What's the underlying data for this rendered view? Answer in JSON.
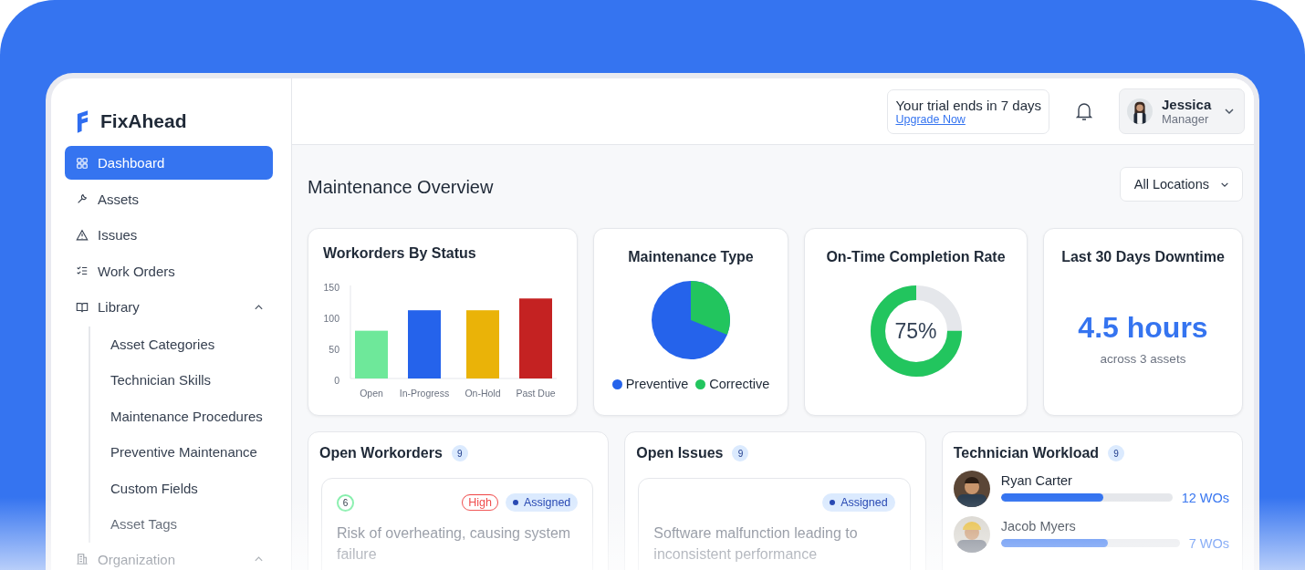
{
  "brand": {
    "name": "FixAhead"
  },
  "sidebar": {
    "items": [
      {
        "label": "Dashboard",
        "selected": true
      },
      {
        "label": "Assets",
        "selected": false
      },
      {
        "label": "Issues",
        "selected": false
      },
      {
        "label": "Work Orders",
        "selected": false
      },
      {
        "label": "Library",
        "selected": false,
        "expanded": true,
        "children": [
          {
            "label": "Asset Categories",
            "selected": false
          },
          {
            "label": "Technician Skills",
            "selected": false
          },
          {
            "label": "Maintenance Procedures",
            "selected": false
          },
          {
            "label": "Preventive Maintenance",
            "selected": false
          },
          {
            "label": "Custom Fields",
            "selected": false
          },
          {
            "label": "Asset Tags",
            "selected": false
          }
        ]
      },
      {
        "label": "Organization",
        "selected": false,
        "expanded": true
      }
    ]
  },
  "header": {
    "trial": {
      "text": "Your trial ends in 7 days",
      "link": "Upgrade Now"
    },
    "user": {
      "name": "Jessica",
      "role": "Manager"
    }
  },
  "page_title": "Maintenance Overview",
  "location_filter": {
    "value": "All Locations"
  },
  "cards": {
    "workorders_by_status": {
      "title": "Workorders By Status",
      "chart_data": {
        "type": "bar",
        "categories": [
          "Open",
          "In-Progress",
          "On-Hold",
          "Past Due"
        ],
        "values": [
          77,
          110,
          110,
          129
        ],
        "colors": [
          "#6ee89a",
          "#2563eb",
          "#eab308",
          "#c42222"
        ],
        "ylim": [
          0,
          150
        ],
        "yticks": [
          0,
          50,
          100,
          150
        ]
      }
    },
    "maintenance_type": {
      "title": "Maintenance Type",
      "legend": [
        {
          "label": "Preventive",
          "color": "#2563eb"
        },
        {
          "label": "Corrective",
          "color": "#22c55e"
        }
      ]
    },
    "completion_rate": {
      "title": "On-Time Completion Rate",
      "level": 0.75,
      "reading": "75%"
    },
    "downtime": {
      "title": "Last 30 Days Downtime",
      "value": "4.5 hours",
      "caption": "across 3 assets"
    }
  },
  "open_workorders": {
    "title": "Open Workorders",
    "count": "9",
    "items": [
      {
        "progress": "6",
        "priority": "High",
        "status": "Assigned",
        "description": "Risk of overheating, causing system failure"
      }
    ]
  },
  "open_issues": {
    "title": "Open Issues",
    "count": "9",
    "items": [
      {
        "status": "Assigned",
        "description": "Software malfunction leading to inconsistent performance"
      }
    ]
  },
  "technician_workload": {
    "title": "Technician Workload",
    "count": "9",
    "technicians": [
      {
        "name": "Ryan Carter",
        "level": 0.6,
        "reading": "12 WOs"
      },
      {
        "name": "Jacob Myers",
        "level": 0.6,
        "reading": "7 WOs"
      }
    ]
  }
}
